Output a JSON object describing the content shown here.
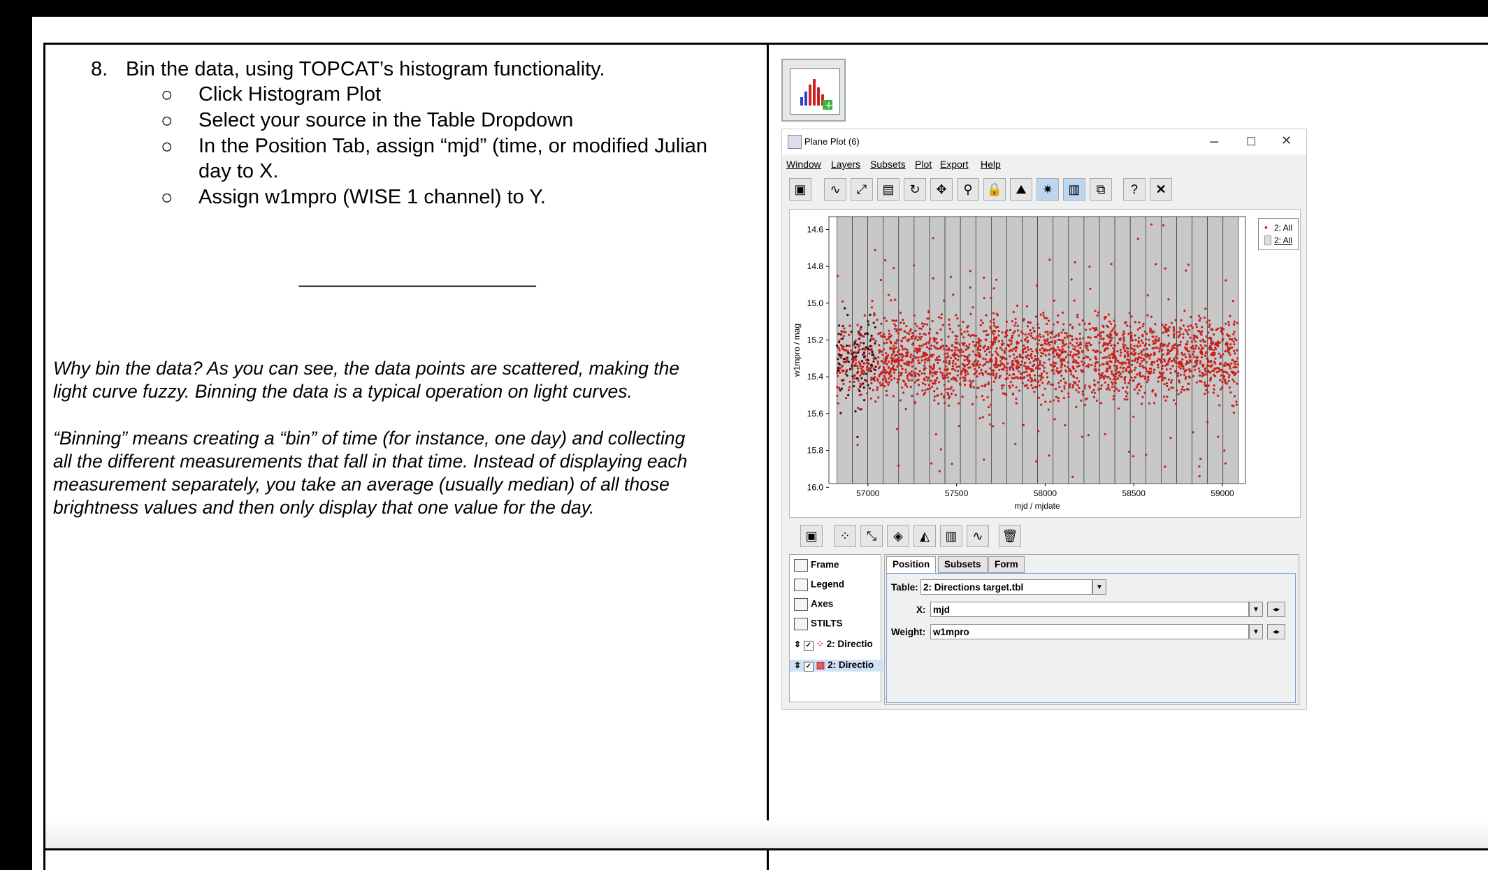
{
  "instructions": {
    "step_number": "8.",
    "step_text": "Bin the data, using TOPCAT’s histogram functionality.",
    "bullets": [
      "Click Histogram Plot",
      "Select your source in the Table Dropdown",
      "In the Position Tab, assign “mjd” (time, or modified Julian",
      "day to X.",
      "Assign w1mpro (WISE 1 channel)  to Y."
    ],
    "bullet_glyph": "○",
    "divider": "_____________________"
  },
  "explanation": {
    "p1": [
      "Why bin the data? As you can see, the data points are scattered, making the",
      "light curve fuzzy. Binning the data is a typical operation on light curves."
    ],
    "p2": [
      "“Binning” means creating a “bin” of time (for instance, one day) and collecting",
      "all the different measurements that fall in that time. Instead of displaying each",
      "measurement separately, you take an average (usually median) of all those",
      "brightness values and then only display that one value for the day."
    ]
  },
  "window": {
    "title": "Plane Plot (6)",
    "min": "–",
    "max": "☐",
    "close": "✕",
    "menus": [
      "Window",
      "Layers",
      "Subsets",
      "Plot",
      "Export",
      "Help"
    ]
  },
  "chart_data": {
    "type": "scatter",
    "xlabel": "mjd / mjdate",
    "ylabel": "w1mpro / mag",
    "x_ticks": [
      "57000",
      "57500",
      "58000",
      "58500",
      "59000"
    ],
    "y_ticks": [
      "14.6",
      "14.8",
      "15.0",
      "15.2",
      "15.4",
      "15.6",
      "15.8",
      "16.0"
    ],
    "xlim": [
      56780,
      59130
    ],
    "ylim": [
      14.53,
      15.98
    ],
    "y_inverted": true,
    "legend": [
      "2: All",
      "2: All"
    ],
    "colors": {
      "points": "#c8201c",
      "dense": "#3a0c0c",
      "bins": "#c8c8c8"
    },
    "description_points": {
      "x_range": [
        56825,
        59090
      ],
      "y_center": 15.3,
      "y_spread": 0.2
    }
  },
  "layers": {
    "items": [
      "Frame",
      "Legend",
      "Axes",
      "STILTS",
      "2: Directio",
      "2: Directio"
    ]
  },
  "layer_props": {
    "tabs": [
      "Position",
      "Subsets",
      "Form"
    ],
    "table_label": "Table:",
    "table_value": "2: Directions target.tbl",
    "x_label": "X:",
    "x_value": "mjd",
    "weight_label": "Weight:",
    "weight_value": "w1mpro"
  }
}
